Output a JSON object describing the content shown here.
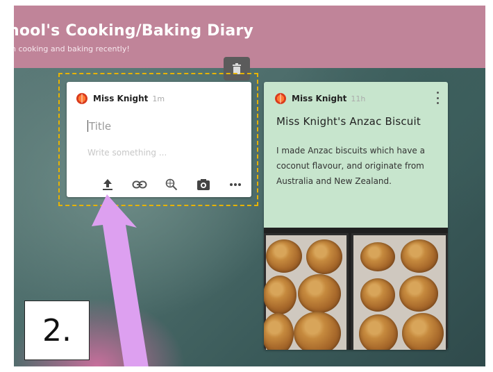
{
  "header": {
    "title": "hool's Cooking/Baking Diary",
    "subtitle": "n cooking and baking recently!"
  },
  "draft_card": {
    "author": "Miss Knight",
    "time": "1m",
    "title_placeholder": "Title",
    "body_placeholder": "Write something ..."
  },
  "post_card": {
    "author": "Miss Knight",
    "time": "11h",
    "title": "Miss Knight's Anzac Biscuit",
    "body": "I made Anzac biscuits which have a coconut flavour, and originate from Australia and New Zealand."
  },
  "annotation": {
    "step_label": "2."
  },
  "icons": [
    "trash-icon",
    "upload-icon",
    "link-icon",
    "search-web-icon",
    "camera-icon",
    "more-icon",
    "kebab-menu-icon"
  ],
  "colors": {
    "header": "#c08499",
    "dashed_outline": "#e7b300",
    "post_card": "#c7e5cd",
    "arrow": "#dda0f0"
  }
}
